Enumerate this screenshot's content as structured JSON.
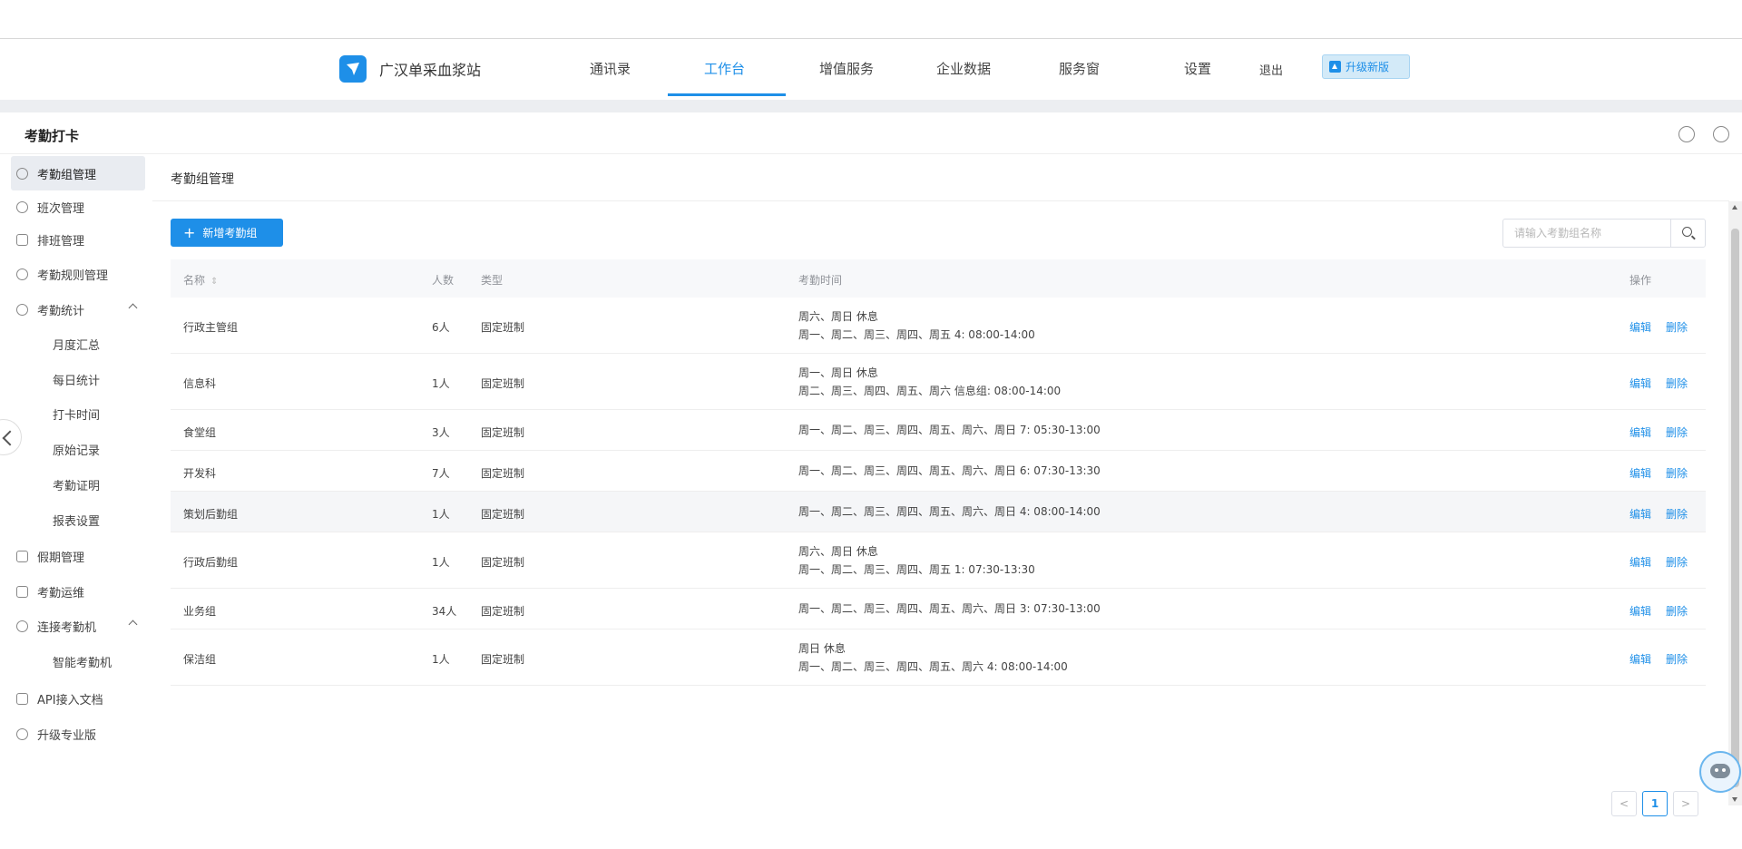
{
  "brand": {
    "name": "广汉单采血浆站"
  },
  "nav": {
    "items": [
      "通讯录",
      "工作台",
      "增值服务",
      "企业数据",
      "服务窗",
      "设置",
      "退出"
    ],
    "active_index": 1,
    "upgrade_label": "升级新版"
  },
  "page": {
    "title": "考勤打卡"
  },
  "sidebar": {
    "items": [
      {
        "label": "考勤组管理",
        "active": true
      },
      {
        "label": "班次管理"
      },
      {
        "label": "排班管理"
      },
      {
        "label": "考勤规则管理"
      },
      {
        "label": "考勤统计",
        "expanded": true
      },
      {
        "label": "月度汇总",
        "sub": true
      },
      {
        "label": "每日统计",
        "sub": true
      },
      {
        "label": "打卡时间",
        "sub": true
      },
      {
        "label": "原始记录",
        "sub": true
      },
      {
        "label": "考勤证明",
        "sub": true
      },
      {
        "label": "报表设置",
        "sub": true
      },
      {
        "label": "假期管理"
      },
      {
        "label": "考勤运维"
      },
      {
        "label": "连接考勤机",
        "expanded": true
      },
      {
        "label": "智能考勤机",
        "sub": true
      },
      {
        "label": "API接入文档"
      },
      {
        "label": "升级专业版"
      }
    ]
  },
  "main": {
    "title": "考勤组管理",
    "add_button": "新增考勤组",
    "search_placeholder": "请输入考勤组名称",
    "columns": {
      "name": "名称",
      "count": "人数",
      "type": "类型",
      "time": "考勤时间",
      "ops": "操作"
    },
    "rows": [
      {
        "name": "行政主管组",
        "count": "6人",
        "type": "固定班制",
        "time_line1": "周六、周日 休息",
        "time_line2": "周一、周二、周三、周四、周五 4: 08:00-14:00",
        "edit": "编辑",
        "del": "删除"
      },
      {
        "name": "信息科",
        "count": "1人",
        "type": "固定班制",
        "time_line1": "周一、周日 休息",
        "time_line2": "周二、周三、周四、周五、周六 信息组: 08:00-14:00",
        "edit": "编辑",
        "del": "删除"
      },
      {
        "name": "食堂组",
        "count": "3人",
        "type": "固定班制",
        "time_line1": "周一、周二、周三、周四、周五、周六、周日 7: 05:30-13:00",
        "edit": "编辑",
        "del": "删除"
      },
      {
        "name": "开发科",
        "count": "7人",
        "type": "固定班制",
        "time_line1": "周一、周二、周三、周四、周五、周六、周日 6: 07:30-13:30",
        "edit": "编辑",
        "del": "删除"
      },
      {
        "name": "策划后勤组",
        "count": "1人",
        "type": "固定班制",
        "time_line1": "周一、周二、周三、周四、周五、周六、周日 4: 08:00-14:00",
        "edit": "编辑",
        "del": "删除"
      },
      {
        "name": "行政后勤组",
        "count": "1人",
        "type": "固定班制",
        "time_line1": "周六、周日 休息",
        "time_line2": "周一、周二、周三、周四、周五 1: 07:30-13:30",
        "edit": "编辑",
        "del": "删除"
      },
      {
        "name": "业务组",
        "count": "34人",
        "type": "固定班制",
        "time_line1": "周一、周二、周三、周四、周五、周六、周日 3: 07:30-13:00",
        "edit": "编辑",
        "del": "删除"
      },
      {
        "name": "保洁组",
        "count": "1人",
        "type": "固定班制",
        "time_line1": "周日 休息",
        "time_line2": "周一、周二、周三、周四、周五、周六 4: 08:00-14:00",
        "edit": "编辑",
        "del": "删除"
      }
    ]
  },
  "pagination": {
    "prev": "<",
    "current": "1",
    "next": ">"
  },
  "colors": {
    "accent": "#1e8fe8",
    "text": "#333333",
    "header_bg": "#f7f8fa",
    "side_active": "#e9ecf1"
  }
}
